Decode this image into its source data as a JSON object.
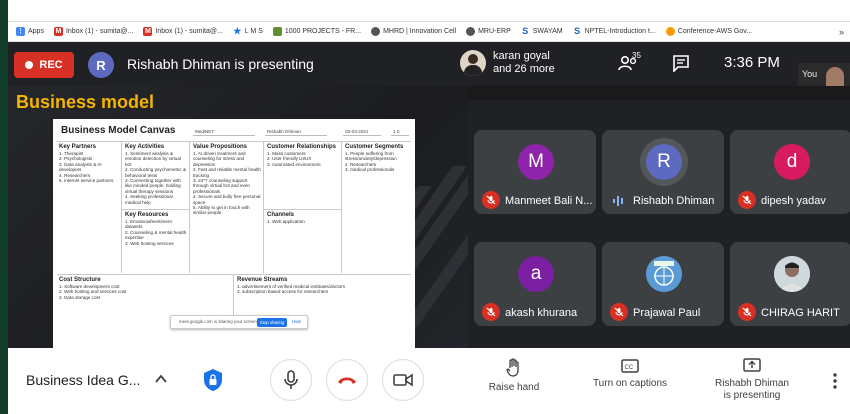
{
  "browser": {
    "bookmarks": [
      {
        "label": "Apps",
        "icon": "apps-grid-icon",
        "color": "#4285f4"
      },
      {
        "label": "Inbox (1) - sumita@...",
        "icon": "gmail-icon",
        "color": "#d93025"
      },
      {
        "label": "Inbox (1) - sumita@...",
        "icon": "gmail-icon",
        "color": "#d93025"
      },
      {
        "label": "L M S",
        "icon": "star-icon",
        "color": "#1a73e8"
      },
      {
        "label": "1000 PROJECTS - FR...",
        "icon": "bookmark-icon",
        "color": "#5f8f2f"
      },
      {
        "label": "MHRD | Innovation Cell",
        "icon": "globe-icon",
        "color": "#555555"
      },
      {
        "label": "MRU-ERP",
        "icon": "globe-icon",
        "color": "#555555"
      },
      {
        "label": "SWAYAM",
        "icon": "swayam-icon",
        "color": "#1565c0"
      },
      {
        "label": "NPTEL-Introduction t...",
        "icon": "nptel-icon",
        "color": "#1565c0"
      },
      {
        "label": "Conference-AWS Gov...",
        "icon": "aws-icon",
        "color": "#ff9900"
      }
    ],
    "more_label": "»"
  },
  "topbar": {
    "rec_label": "REC",
    "presenter_initial": "R",
    "presenter_text": "Rishabh Dhiman is presenting",
    "host_name": "karan goyal",
    "host_more": "and 26 more",
    "people_count": "35",
    "time": "3:36 PM",
    "you_label": "You"
  },
  "slide": {
    "title": "Business model",
    "canvas_title": "Business Model Canvas",
    "meta": [
      "MediNET",
      "Rishabh Dhiman",
      "03-03-2021",
      "1.0"
    ],
    "key_partners_h": "Key Partners",
    "key_partners": "1. Therapist\n2. Psychologists\n3. Data analysts & AI developers\n4. Researchers\n5. internet service partners",
    "key_activities_h": "Key Activities",
    "key_activities": "1. Sentiment analysis & emotion detection by virtual bot\n2. Conducting psychometric & behavioral tests\n3. Connecting together with like minded people, holding virtual therapy sessions\n4. Seeking professional medical help",
    "value_prop_h": "Value Propositions",
    "value_prop": "1. AI driven treatment and counseling for stress and depression\n2. Fast and reliable mental health tracking\n3. 24*7 counseling support through virtual bot and even professionals\n4. Secure and bully free personal space\n5. Ability to get in touch with similar people",
    "cust_rel_h": "Customer Relationships",
    "cust_rel": "1. Mass customers\n2. User friendly UI/UX\n3. Automated environment",
    "cust_seg_h": "Customer Segments",
    "cust_seg": "1. People suffering from stress/anxiety/depression\n2. Researchers\n3. medical professionals",
    "key_res_h": "Key Resources",
    "key_res": "1. Emotional/sentiment datasets\n2. Counseling & mental health expertise\n3. Web hosting services",
    "channels_h": "Channels",
    "channels": "1. Web application",
    "cost_h": "Cost Structure",
    "cost": "1. Software development cost\n2. Web hosting and services cost\n3. Data storage cost",
    "revenue_h": "Revenue Streams",
    "revenue": "1. advertisement of verified medical institutes/doctors\n2. subscription based access for researchers",
    "share_text": "meet.google.com is sharing your screen.",
    "stop_label": "Stop sharing",
    "hide_label": "Hide"
  },
  "participants": [
    {
      "name": "Manmeet Bali N...",
      "initial": "M",
      "color": "#8e24aa",
      "muted": true
    },
    {
      "name": "Rishabh Dhiman",
      "initial": "R",
      "color": "#5c6bc0",
      "muted": false
    },
    {
      "name": "dipesh yadav",
      "initial": "d",
      "color": "#d81b60",
      "muted": true
    },
    {
      "name": "akash khurana",
      "initial": "a",
      "color": "#7b1fa2",
      "muted": true
    },
    {
      "name": "Prajawal Paul",
      "initial": "",
      "color": "#5b9bd5",
      "muted": true
    },
    {
      "name": "CHIRAG HARIT",
      "initial": "",
      "color": "#cfd8dc",
      "muted": true
    }
  ],
  "bottombar": {
    "meeting_name": "Business Idea G...",
    "raise_hand": "Raise hand",
    "captions": "Turn on captions",
    "presenting_line1": "Rishabh Dhiman",
    "presenting_line2": "is presenting"
  },
  "colors": {
    "accent_red": "#d93025",
    "slide_title": "#f4b400",
    "dark_bg": "#202124"
  }
}
